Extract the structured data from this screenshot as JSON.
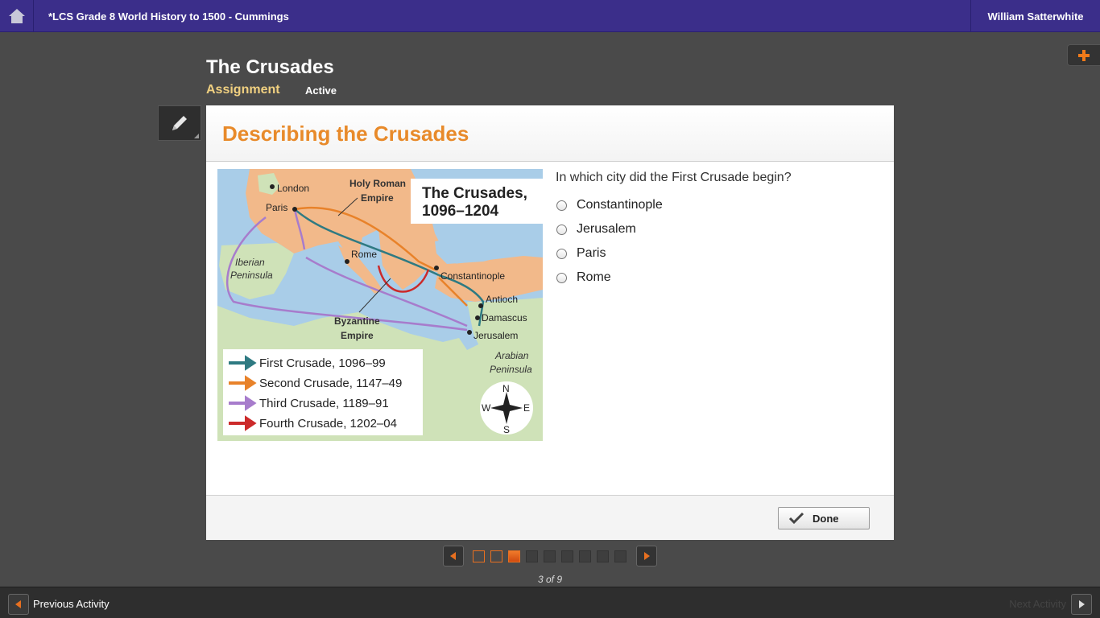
{
  "topbar": {
    "course_title": "*LCS Grade 8 World History to 1500 - Cummings",
    "user_name": "William Satterwhite"
  },
  "lesson": {
    "title": "The Crusades",
    "type": "Assignment",
    "status": "Active"
  },
  "activity": {
    "title": "Describing the Crusades",
    "map": {
      "title_line1": "The Crusades,",
      "title_line2": "1096–1204",
      "places": {
        "london": "London",
        "paris": "Paris",
        "hre_line1": "Holy Roman",
        "hre_line2": "Empire",
        "iberian_line1": "Iberian",
        "iberian_line2": "Peninsula",
        "rome": "Rome",
        "constantinople": "Constantinople",
        "antioch": "Antioch",
        "damascus": "Damascus",
        "jerusalem": "Jerusalem",
        "byz_line1": "Byzantine",
        "byz_line2": "Empire",
        "arabian_line1": "Arabian",
        "arabian_line2": "Peninsula"
      },
      "legend": [
        {
          "label": "First Crusade, 1096–99",
          "color": "#2e7a82"
        },
        {
          "label": "Second Crusade, 1147–49",
          "color": "#e8822a"
        },
        {
          "label": "Third Crusade, 1189–91",
          "color": "#a77ccc"
        },
        {
          "label": "Fourth Crusade, 1202–04",
          "color": "#cc2a2a"
        }
      ],
      "compass": {
        "n": "N",
        "s": "S",
        "e": "E",
        "w": "W"
      }
    },
    "question": "In which city did the First Crusade begin?",
    "options": [
      "Constantinople",
      "Jerusalem",
      "Paris",
      "Rome"
    ],
    "done_label": "Done"
  },
  "pager": {
    "count_text": "3 of 9",
    "current": 3,
    "total": 9
  },
  "bottom_nav": {
    "prev_label": "Previous Activity",
    "next_label": "Next Activity"
  },
  "colors": {
    "topbar": "#3b2e8a",
    "accent_orange": "#e88a2a",
    "background": "#4a4a4a"
  }
}
